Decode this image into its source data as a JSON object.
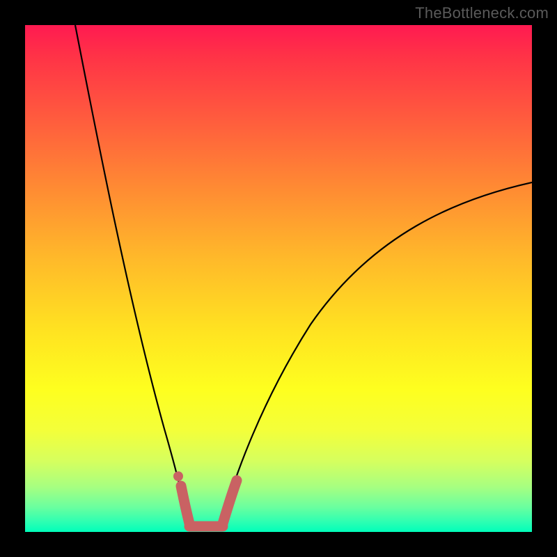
{
  "watermark": "TheBottleneck.com",
  "chart_data": {
    "type": "line",
    "title": "",
    "xlabel": "",
    "ylabel": "",
    "xlim": [
      0,
      100
    ],
    "ylim": [
      0,
      100
    ],
    "series": [
      {
        "name": "left-branch",
        "x": [
          10,
          12,
          15,
          18,
          21,
          24,
          27,
          30,
          31.5
        ],
        "y": [
          100,
          86,
          68,
          52,
          38,
          26,
          15,
          6,
          2
        ]
      },
      {
        "name": "right-branch",
        "x": [
          38,
          40,
          44,
          50,
          58,
          68,
          80,
          92,
          100
        ],
        "y": [
          2,
          6,
          14,
          24,
          35,
          46,
          56,
          64,
          69
        ]
      },
      {
        "name": "highlight-band",
        "x": [
          29,
          30,
          32,
          34,
          36,
          38,
          39
        ],
        "y": [
          4,
          2,
          0.5,
          0.5,
          0.5,
          2,
          4
        ]
      }
    ],
    "highlight_color": "#c96263",
    "curve_color": "#000000",
    "background_gradient": [
      "#ff1a51",
      "#ffe221",
      "#00ffba"
    ]
  }
}
